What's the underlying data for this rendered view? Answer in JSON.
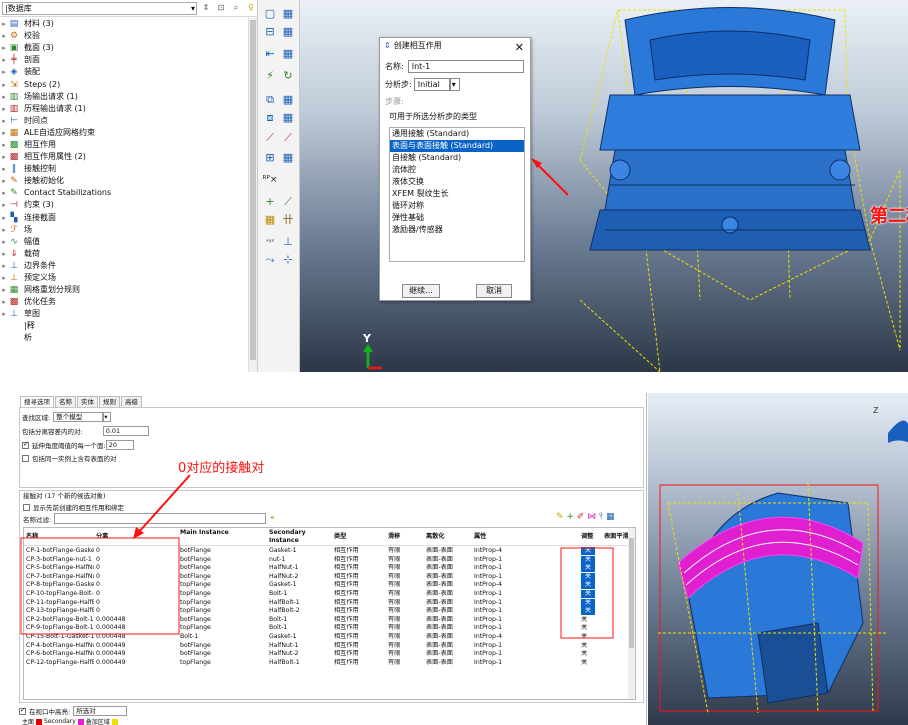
{
  "tree": {
    "combo_label": "|数据库",
    "items": [
      {
        "label": "材料 (3)",
        "icon": "material-icon",
        "glyph": "▤"
      },
      {
        "label": "校验",
        "icon": "calibration-icon",
        "glyph": "⚙"
      },
      {
        "label": "截面 (3)",
        "icon": "section-icon",
        "glyph": "▣"
      },
      {
        "label": "剖面",
        "icon": "profile-icon",
        "glyph": "╪"
      },
      {
        "label": "装配",
        "icon": "assembly-icon",
        "glyph": "◈"
      },
      {
        "label": "Steps (2)",
        "icon": "steps-icon",
        "glyph": "⇲"
      },
      {
        "label": "场输出请求 (1)",
        "icon": "field-output-icon",
        "glyph": "▥"
      },
      {
        "label": "历程输出请求 (1)",
        "icon": "history-output-icon",
        "glyph": "▥"
      },
      {
        "label": "时间点",
        "icon": "time-points-icon",
        "glyph": "⊢"
      },
      {
        "label": "ALE自适应网格约束",
        "icon": "ale-icon",
        "glyph": "▦"
      },
      {
        "label": "相互作用",
        "icon": "interaction-icon",
        "glyph": "▩"
      },
      {
        "label": "相互作用属性 (2)",
        "icon": "interaction-property-icon",
        "glyph": "▩"
      },
      {
        "label": "接触控制",
        "icon": "contact-control-icon",
        "glyph": "‖"
      },
      {
        "label": "接触初始化",
        "icon": "contact-init-icon",
        "glyph": "✎"
      },
      {
        "label": "Contact Stabilizations",
        "icon": "contact-stabilization-icon",
        "glyph": "✎"
      },
      {
        "label": "约束 (3)",
        "icon": "constraint-icon",
        "glyph": "⊣"
      },
      {
        "label": "连接截面",
        "icon": "connector-section-icon",
        "glyph": "▚"
      },
      {
        "label": "场",
        "icon": "field-icon",
        "glyph": "ℱ"
      },
      {
        "label": "幅值",
        "icon": "amplitude-icon",
        "glyph": "∿"
      },
      {
        "label": "载荷",
        "icon": "load-icon",
        "glyph": "⇓"
      },
      {
        "label": "边界条件",
        "icon": "bc-icon",
        "glyph": "⊥"
      },
      {
        "label": "预定义场",
        "icon": "predefined-field-icon",
        "glyph": "⊥"
      },
      {
        "label": "网格重划分规则",
        "icon": "remesh-icon",
        "glyph": "▦"
      },
      {
        "label": "优化任务",
        "icon": "optimization-icon",
        "glyph": "▩"
      },
      {
        "label": "草图",
        "icon": "sketch-icon",
        "glyph": "⊥"
      },
      {
        "label": "|释",
        "icon": "",
        "glyph": ""
      },
      {
        "label": "析",
        "icon": "",
        "glyph": ""
      }
    ]
  },
  "dialog": {
    "title": "创建相互作用",
    "name_label": "名称:",
    "name_value": "Int-1",
    "step_label": "分析步:",
    "step_value": "Initial",
    "procedure_label": "步骤:",
    "types_label": "可用于所选分析步的类型",
    "types": [
      "通用接触 (Standard)",
      "表面与表面接触 (Standard)",
      "自接触 (Standard)",
      "流体腔",
      "液体交换",
      "XFEM 裂纹生长",
      "循环对称",
      "弹性基础",
      "激励器/传感器"
    ],
    "selected_index": 1,
    "continue_label": "继续...",
    "cancel_label": "取消"
  },
  "annotations": {
    "top_note": "第二种方法采用通用接触定义",
    "bottom_note": "0对应的接触对",
    "color": "#ff1010"
  },
  "axis": {
    "y_label": "Y",
    "z_label": "Z"
  },
  "search": {
    "tabs": [
      "搜寻选项",
      "名称",
      "实体",
      "规则",
      "高级"
    ],
    "domain_label": "查找区域:",
    "domain_value": "整个模型",
    "separation_label": "包括分离容差内的对:",
    "separation_value": "0.01",
    "extend_label": "延伸角度阈值的每一个面:",
    "extend_value": "20",
    "same_instance_label": "包括同一实例上含有表面的对"
  },
  "results": {
    "summary": "接触对 (17 个新的候选对象)",
    "show_previous": "显示先前创建的相互作用和绑定",
    "filter_label": "名称过滤:",
    "columns": [
      "名称",
      "分离",
      "Main Instance",
      "Secondary Instance",
      "类型",
      "滑移",
      "离散化",
      "属性",
      "调整",
      "表面平滑"
    ],
    "rows": [
      [
        "CP-1-botFlange-Gaske",
        "0",
        "botFlange",
        "Gasket-1",
        "相互作用",
        "有限",
        "表面-表面",
        "IntProp-4",
        "关"
      ],
      [
        "CP-3-botFlange-nut-1",
        "0",
        "botFlange",
        "nut-1",
        "相互作用",
        "有限",
        "表面-表面",
        "IntProp-1",
        "关"
      ],
      [
        "CP-5-botFlange-HalfNu",
        "0",
        "botFlange",
        "HalfNut-1",
        "相互作用",
        "有限",
        "表面-表面",
        "IntProp-1",
        "关"
      ],
      [
        "CP-7-botFlange-HalfNu",
        "0",
        "botFlange",
        "HalfNut-2",
        "相互作用",
        "有限",
        "表面-表面",
        "IntProp-1",
        "关"
      ],
      [
        "CP-8-topFlange-Gaske",
        "0",
        "topFlange",
        "Gasket-1",
        "相互作用",
        "有限",
        "表面-表面",
        "IntProp-4",
        "关"
      ],
      [
        "CP-10-topFlange-Bolt-",
        "0",
        "topFlange",
        "Bolt-1",
        "相互作用",
        "有限",
        "表面-表面",
        "IntProp-1",
        "关"
      ],
      [
        "CP-11-topFlange-HalfB",
        "0",
        "topFlange",
        "HalfBolt-1",
        "相互作用",
        "有限",
        "表面-表面",
        "IntProp-1",
        "关"
      ],
      [
        "CP-13-topFlange-HalfB",
        "0",
        "topFlange",
        "HalfBolt-2",
        "相互作用",
        "有限",
        "表面-表面",
        "IntProp-1",
        "关"
      ],
      [
        "CP-2-botFlange-Bolt-1",
        "0.000448",
        "botFlange",
        "Bolt-1",
        "相互作用",
        "有限",
        "表面-表面",
        "IntProp-1",
        "关"
      ],
      [
        "CP-9-topFlange-Bolt-1",
        "0.000448",
        "topFlange",
        "Bolt-1",
        "相互作用",
        "有限",
        "表面-表面",
        "IntProp-1",
        "关"
      ],
      [
        "CP-15-Bolt-1-Gasket-1",
        "0.000448",
        "Bolt-1",
        "Gasket-1",
        "相互作用",
        "有限",
        "表面-表面",
        "IntProp-4",
        "关"
      ],
      [
        "CP-4-botFlange-HalfNu",
        "0.000449",
        "botFlange",
        "HalfNut-1",
        "相互作用",
        "有限",
        "表面-表面",
        "IntProp-1",
        "关"
      ],
      [
        "CP-6-botFlange-HalfNu",
        "0.000449",
        "botFlange",
        "HalfNut-2",
        "相互作用",
        "有限",
        "表面-表面",
        "IntProp-1",
        "关"
      ],
      [
        "CP-12-topFlange-HalfB",
        "0.000449",
        "topFlange",
        "HalfBolt-1",
        "相互作用",
        "有限",
        "表面-表面",
        "IntProp-1",
        "关"
      ]
    ],
    "highlighted_rows": 8,
    "highlight_prefix": "CP-",
    "viewport_option_label": "在视口中高亮:",
    "viewport_option_value": "所选对",
    "legend_main": "主面",
    "legend_secondary": "Secondary",
    "legend_overlap": "叠加区域"
  },
  "colors": {
    "part_blue": "#2a78d8",
    "part_dark": "#1a4f96",
    "selection_blue": "#0a64c8",
    "wire_yellow": "#f0e000",
    "contact_magenta": "#e020d0",
    "legend_red": "#e00000",
    "legend_magenta": "#e020d0",
    "legend_yellow": "#f0e000"
  }
}
